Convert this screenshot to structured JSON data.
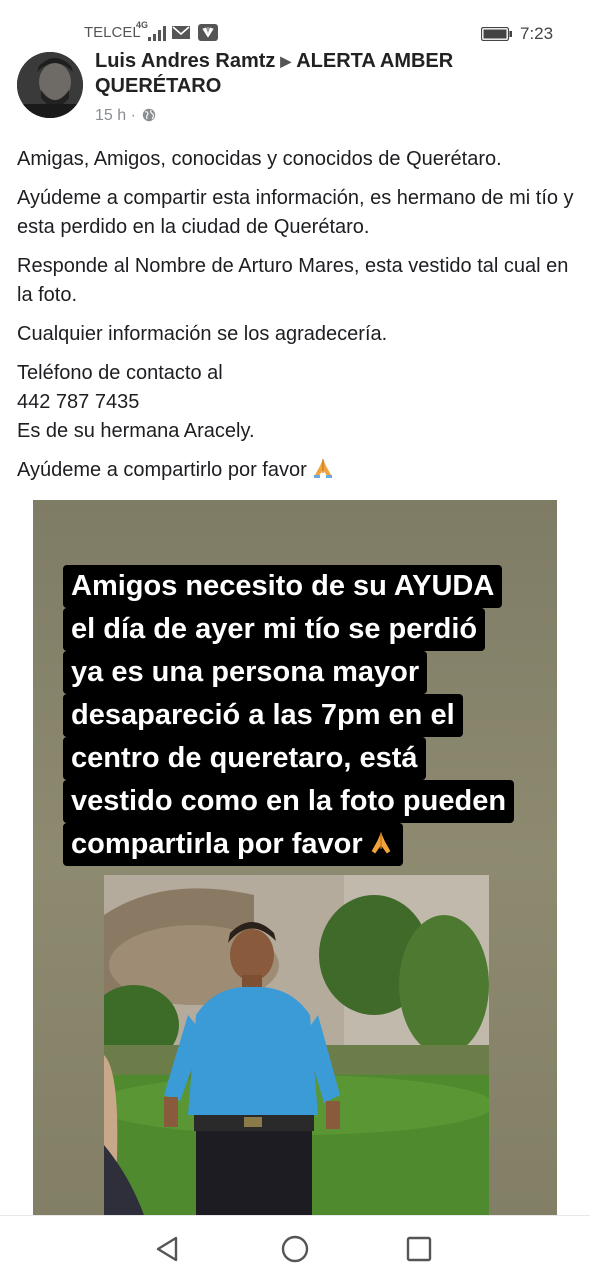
{
  "status_bar": {
    "carrier": "TELCEL",
    "network": "4G",
    "time": "7:23"
  },
  "post": {
    "author": "Luis Andres Ramtz",
    "group": "ALERTA AMBER QUERÉTARO",
    "time_ago": "15 h ·",
    "paragraphs": [
      "Amigas, Amigos, conocidas y conocidos de Querétaro.",
      "Ayúdeme a compartir esta información, es hermano de mi tío y esta perdido en la ciudad de Querétaro.",
      "Responde al Nombre de Arturo Mares, esta vestido tal cual en la foto.",
      "Cualquier información se los agradecería."
    ],
    "contact_lines": [
      "Teléfono de contacto al",
      "442 787 7435",
      "Es de su hermana Aracely."
    ],
    "closing": "Ayúdeme a compartirlo por favor"
  },
  "image": {
    "caption_lines": [
      "Amigos necesito de su AYUDA",
      "el día de ayer mi tío se perdió",
      "ya es una persona mayor",
      "desapareció a las 7pm en el",
      "centro de queretaro, está",
      "vestido como en la foto pueden",
      "compartirla por favor"
    ]
  },
  "icons": {
    "avatar": "avatar",
    "globe": "globe-icon",
    "pray": "folded-hands-emoji",
    "back": "back-triangle-icon",
    "home": "home-circle-icon",
    "recents": "recents-square-icon"
  },
  "colors": {
    "text": "#1c1e21",
    "meta": "#8a8d91",
    "caption_bg": "#000000",
    "caption_text": "#ffffff"
  }
}
